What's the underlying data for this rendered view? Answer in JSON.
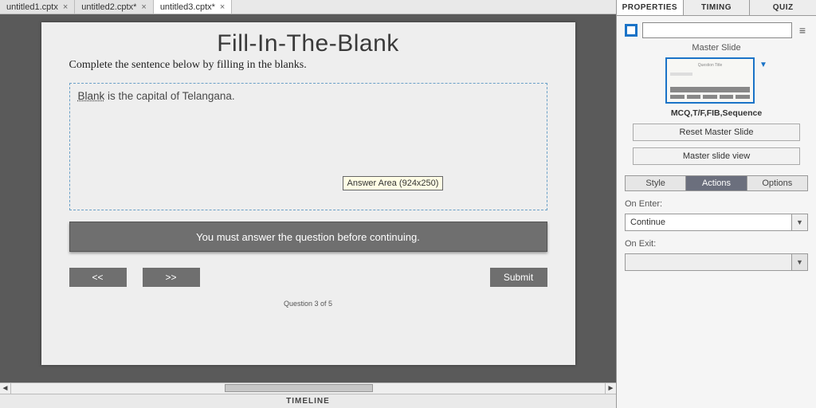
{
  "doc_tabs": [
    {
      "label": "untitled1.cptx",
      "active": false
    },
    {
      "label": "untitled2.cptx*",
      "active": false
    },
    {
      "label": "untitled3.cptx*",
      "active": true
    }
  ],
  "slide": {
    "title": "Fill-In-The-Blank",
    "instruction": "Complete the sentence below by filling in the blanks.",
    "blank_word": "Blank",
    "sentence_rest": " is the capital of Telangana.",
    "tooltip": "Answer Area (924x250)",
    "feedback": "You must answer the question before continuing.",
    "prev": "<<",
    "next": ">>",
    "submit": "Submit",
    "counter": "Question 3 of 5"
  },
  "timeline_label": "TIMELINE",
  "panel_tabs": {
    "properties": "PROPERTIES",
    "timing": "TIMING",
    "quiz": "QUIZ"
  },
  "panel": {
    "name_value": "",
    "master_label": "Master Slide",
    "master_thumb_title": "Question Title",
    "master_name": "MCQ,T/F,FIB,Sequence",
    "reset_btn": "Reset Master Slide",
    "view_btn": "Master slide view",
    "sub_tabs": {
      "style": "Style",
      "actions": "Actions",
      "options": "Options"
    },
    "on_enter_label": "On Enter:",
    "on_enter_value": "Continue",
    "on_exit_label": "On Exit:",
    "on_exit_value": ""
  }
}
